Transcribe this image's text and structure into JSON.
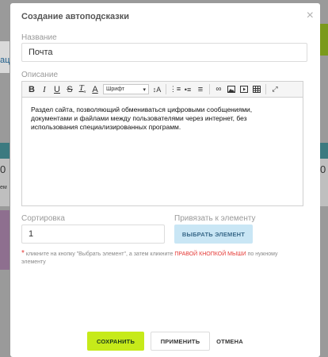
{
  "background": {
    "left_tab_text": "ац",
    "left_number": "0",
    "left_text": "ем",
    "right_number": "0"
  },
  "modal": {
    "title": "Создание автоподсказки",
    "close_icon": "×"
  },
  "form": {
    "name_label": "Название",
    "name_value": "Почта",
    "description_label": "Описание",
    "description_text": "Раздел сайта, позволяющий обмениваться цифровыми сообщениями, документами и файлами между пользователями через интернет, без использования специализированных программ.",
    "sort_label": "Сортировка",
    "sort_value": "1",
    "bind_label": "Привязать к элементу",
    "select_element_button": "ВЫБРАТЬ ЭЛЕМЕНТ",
    "hint_prefix": "кликните на кнопку \"Выбрать элемент\", а затем кликните",
    "hint_highlight": "ПРАВОЙ КНОПКОЙ МЫШИ",
    "hint_suffix": "по нужному элементу"
  },
  "toolbar": {
    "font_select": "Шрифт",
    "items": [
      "bold-icon",
      "italic-icon",
      "underline-icon",
      "strikethrough-icon",
      "clear-format-icon",
      "text-color-icon",
      "font-select",
      "font-size-icon",
      "numbered-list-icon",
      "bulleted-list-icon",
      "align-icon",
      "link-icon",
      "image-icon",
      "video-icon",
      "table-icon",
      "fullscreen-icon"
    ]
  },
  "footer": {
    "save_button": "СОХРАНИТЬ",
    "apply_button": "ПРИМЕНИТЬ",
    "cancel_button": "ОТМЕНА"
  },
  "colors": {
    "save_button_bg": "#c6ea1a",
    "select_button_bg": "#c9e6f5",
    "accent_red": "#e53935"
  }
}
